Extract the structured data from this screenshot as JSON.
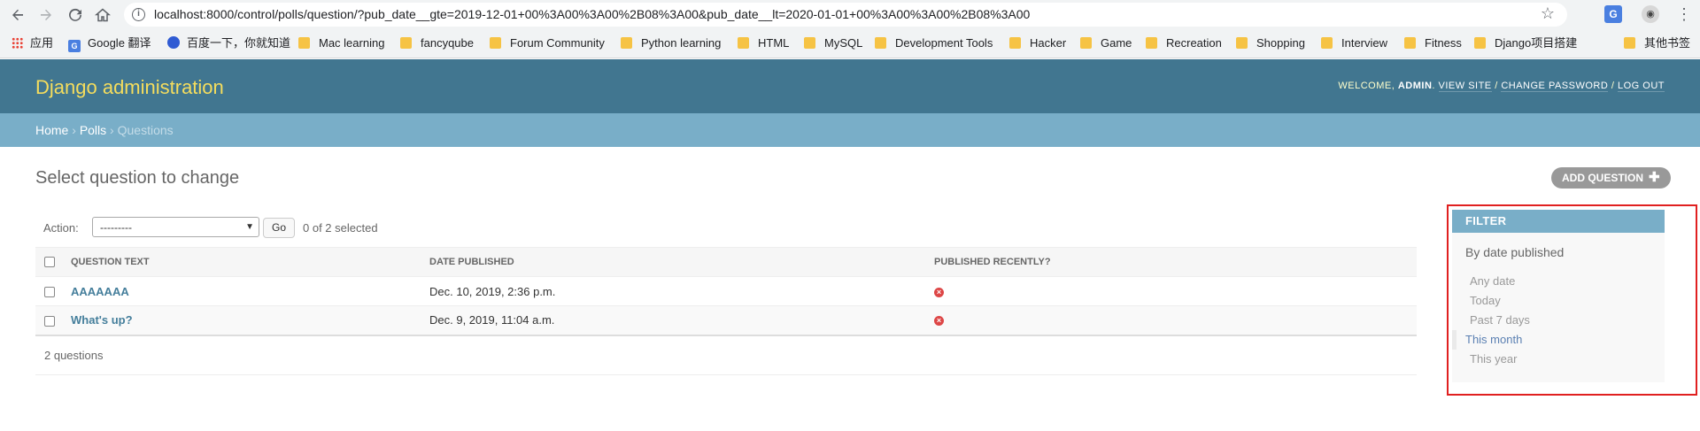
{
  "browser": {
    "url": "localhost:8000/control/polls/question/?pub_date__gte=2019-12-01+00%3A00%3A00%2B08%3A00&pub_date__lt=2020-01-01+00%3A00%3A00%2B08%3A00",
    "bookmarks": [
      {
        "label": "应用",
        "icon": "apps-grid-icon"
      },
      {
        "label": "Google 翻译",
        "icon": "google-translate-icon"
      },
      {
        "label": "百度一下，你就知道",
        "icon": "baidu-paw-icon"
      },
      {
        "label": "Mac learning",
        "icon": "folder-icon"
      },
      {
        "label": "fancyqube",
        "icon": "folder-icon"
      },
      {
        "label": "Forum Community",
        "icon": "folder-icon"
      },
      {
        "label": "Python learning",
        "icon": "folder-icon"
      },
      {
        "label": "HTML",
        "icon": "folder-icon"
      },
      {
        "label": "MySQL",
        "icon": "folder-icon"
      },
      {
        "label": "Development Tools",
        "icon": "folder-icon"
      },
      {
        "label": "Hacker",
        "icon": "folder-icon"
      },
      {
        "label": "Game",
        "icon": "folder-icon"
      },
      {
        "label": "Recreation",
        "icon": "folder-icon"
      },
      {
        "label": "Shopping",
        "icon": "folder-icon"
      },
      {
        "label": "Interview",
        "icon": "folder-icon"
      },
      {
        "label": "Fitness",
        "icon": "folder-icon"
      },
      {
        "label": "Django项目搭建",
        "icon": "folder-icon"
      },
      {
        "label": "其他书签",
        "icon": "folder-icon"
      }
    ]
  },
  "header": {
    "branding": "Django administration",
    "welcome": "WELCOME, ",
    "username": "ADMIN",
    "view_site": "VIEW SITE",
    "change_password": "CHANGE PASSWORD",
    "log_out": "LOG OUT",
    "sep": " / "
  },
  "breadcrumbs": {
    "home": "Home",
    "polls": "Polls",
    "current": "Questions",
    "sep": " › "
  },
  "content": {
    "title": "Select question to change",
    "add_button": "ADD QUESTION"
  },
  "actions": {
    "label": "Action:",
    "select_value": "---------",
    "go": "Go",
    "count": "0 of 2 selected"
  },
  "table": {
    "columns": [
      "QUESTION TEXT",
      "DATE PUBLISHED",
      "PUBLISHED RECENTLY?"
    ],
    "rows": [
      {
        "question": "AAAAAAA",
        "date": "Dec. 10, 2019, 2:36 p.m.",
        "recent": false
      },
      {
        "question": "What's up?",
        "date": "Dec. 9, 2019, 11:04 a.m.",
        "recent": false
      }
    ]
  },
  "paginator": "2 questions",
  "filter": {
    "title": "FILTER",
    "subtitle": "By date published",
    "options": [
      "Any date",
      "Today",
      "Past 7 days",
      "This month",
      "This year"
    ],
    "selected": "This month"
  },
  "colors": {
    "header_bg": "#417690",
    "breadcrumb_bg": "#79aec8",
    "branding": "#f5dd5d",
    "link": "#447e9b",
    "annotation": "#e02020"
  }
}
